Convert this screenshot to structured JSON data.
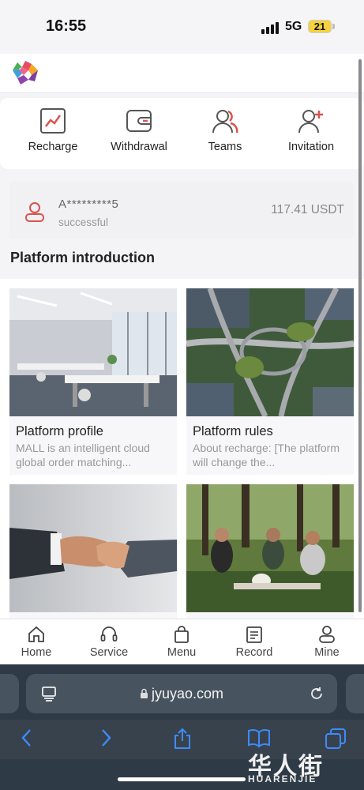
{
  "status_bar": {
    "time": "16:55",
    "network": "5G",
    "battery": "21"
  },
  "quick_actions": [
    {
      "label": "Recharge",
      "icon": "chart-line-icon"
    },
    {
      "label": "Withdrawal",
      "icon": "wallet-icon"
    },
    {
      "label": "Teams",
      "icon": "team-icon"
    },
    {
      "label": "Invitation",
      "icon": "user-add-icon"
    }
  ],
  "recent_record": {
    "account": "A*********5",
    "status": "successful",
    "amount": "117.41 USDT"
  },
  "section_title": "Platform introduction",
  "intro_cards": [
    {
      "title": "Platform profile",
      "desc": "MALL is an intelligent cloud global order matching..."
    },
    {
      "title": "Platform rules",
      "desc": "About recharge: [The platform will change the..."
    },
    {
      "title": "",
      "desc": ""
    },
    {
      "title": "",
      "desc": ""
    }
  ],
  "tabbar": [
    {
      "label": "Home",
      "icon": "home-icon"
    },
    {
      "label": "Service",
      "icon": "headset-icon"
    },
    {
      "label": "Menu",
      "icon": "bag-icon"
    },
    {
      "label": "Record",
      "icon": "document-icon"
    },
    {
      "label": "Mine",
      "icon": "person-icon"
    }
  ],
  "browser": {
    "url": "jyuyao.com"
  },
  "watermark": {
    "text": "HUARENJIE",
    "glyphs": "华人街"
  },
  "colors": {
    "accent_red": "#d9534f",
    "safari_bg": "#2e3a45"
  }
}
